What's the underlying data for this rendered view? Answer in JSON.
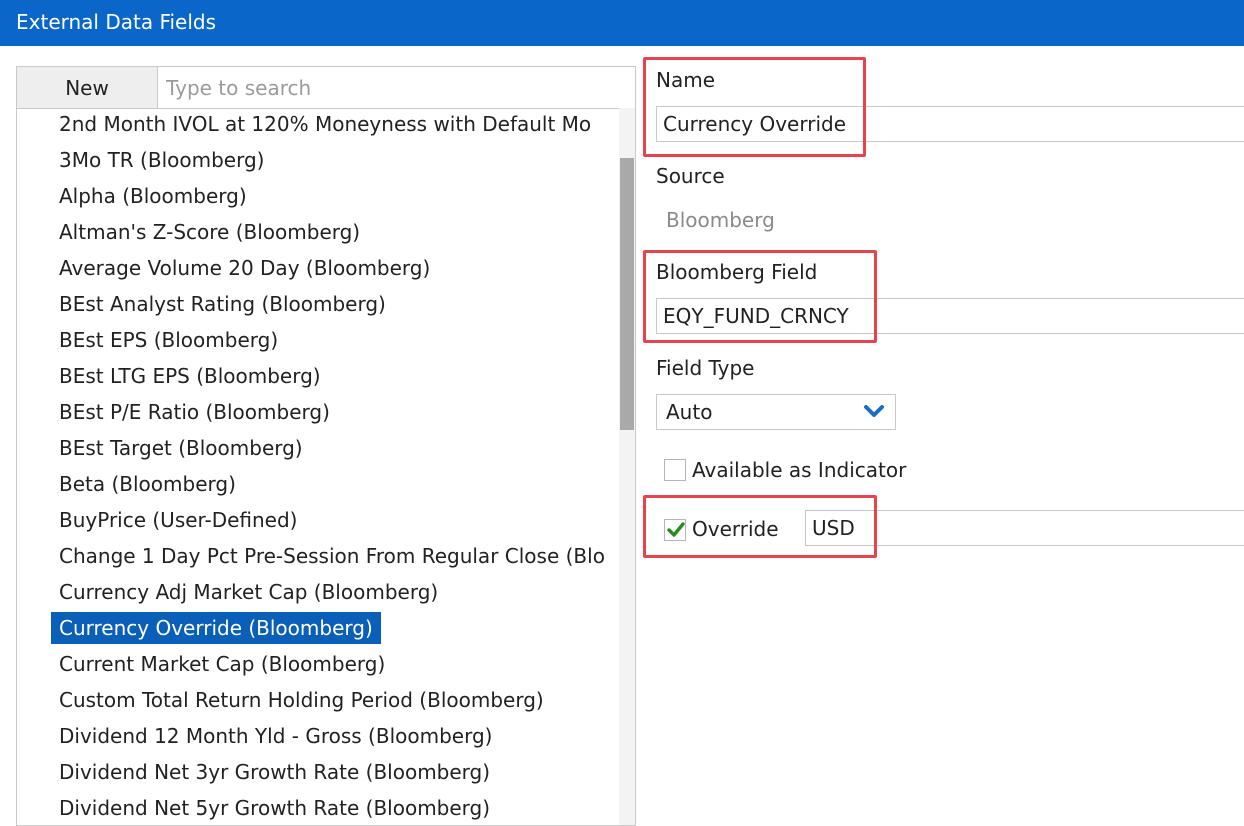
{
  "window": {
    "title": "External Data Fields"
  },
  "toolbar": {
    "new_label": "New",
    "search_placeholder": "Type to search"
  },
  "fields_list": {
    "items": [
      "2nd Month IVOL at 120% Moneyness with Default Mo",
      "3Mo TR (Bloomberg)",
      "Alpha (Bloomberg)",
      "Altman's Z-Score (Bloomberg)",
      "Average Volume 20 Day (Bloomberg)",
      "BEst Analyst Rating (Bloomberg)",
      "BEst EPS (Bloomberg)",
      "BEst LTG EPS (Bloomberg)",
      "BEst P/E Ratio (Bloomberg)",
      "BEst Target (Bloomberg)",
      "Beta (Bloomberg)",
      "BuyPrice (User-Defined)",
      "Change 1 Day Pct Pre-Session From Regular Close (Blo",
      "Currency Adj Market Cap (Bloomberg)",
      "Currency Override (Bloomberg)",
      "Current Market Cap (Bloomberg)",
      "Custom Total Return Holding Period (Bloomberg)",
      "Dividend 12 Month Yld - Gross (Bloomberg)",
      "Dividend Net 3yr Growth Rate (Bloomberg)",
      "Dividend Net 5yr Growth Rate (Bloomberg)"
    ],
    "selected_index": 14
  },
  "details": {
    "name_label": "Name",
    "name_value": "Currency Override",
    "source_label": "Source",
    "source_value": "Bloomberg",
    "bloomberg_field_label": "Bloomberg Field",
    "bloomberg_field_value": "EQY_FUND_CRNCY",
    "field_type_label": "Field Type",
    "field_type_value": "Auto",
    "available_indicator_label": "Available as Indicator",
    "available_indicator_checked": false,
    "override_label": "Override",
    "override_checked": true,
    "override_value": "USD"
  },
  "colors": {
    "titlebar": "#0a66c9",
    "selection": "#0a5fb8",
    "highlight": "#e8424a",
    "checkmark": "#2a8a1f",
    "chevron": "#1a6fc4"
  }
}
